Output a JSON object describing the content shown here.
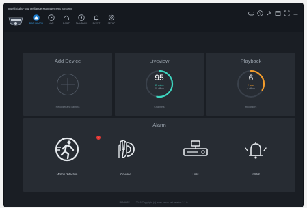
{
  "app": {
    "title": "IntelliSight - Surveillance Management System"
  },
  "nav": [
    {
      "label": "DASHBOARD",
      "icon": "home-icon",
      "active": true
    },
    {
      "label": "LIVE",
      "icon": "play-icon",
      "active": false
    },
    {
      "label": "E-MAP",
      "icon": "map-icon",
      "active": false
    },
    {
      "label": "PLAYBACK",
      "icon": "playback-icon",
      "active": false
    },
    {
      "label": "EVENT",
      "icon": "bell-icon",
      "active": false
    },
    {
      "label": "SETUP",
      "icon": "gear-icon",
      "active": false
    }
  ],
  "window_controls": [
    "cloud-icon",
    "help-icon",
    "pin-icon",
    "window-icon",
    "fullscreen-icon",
    "minimize-icon"
  ],
  "cards": {
    "add_device": {
      "title": "Add Device",
      "subtitle": "Recorder and camera"
    },
    "liveview": {
      "title": "Liveview",
      "count": "95",
      "online": "45 online",
      "offline": "40 offline",
      "online_fraction": 0.53,
      "subtitle": "Channels",
      "accent": "#3dd6c0"
    },
    "playback": {
      "title": "Playback",
      "count": "6",
      "have": "2 have",
      "offline": "4 offline",
      "have_fraction": 0.33,
      "subtitle": "Recorders",
      "accent": "#f39c2b"
    }
  },
  "alarm": {
    "title": "Alarm",
    "items": [
      {
        "label": "Motion detection",
        "icon": "motion-detection-icon",
        "badge": "1"
      },
      {
        "label": "Covered",
        "icon": "covered-icon"
      },
      {
        "label": "Loss",
        "icon": "video-loss-icon"
      },
      {
        "label": "In/Out",
        "icon": "in-out-alarm-icon"
      }
    ]
  },
  "footer": {
    "brand": "PANAVIS",
    "text": "2016 Copyright (c) www.xxxxx.net version 2.1.0"
  }
}
